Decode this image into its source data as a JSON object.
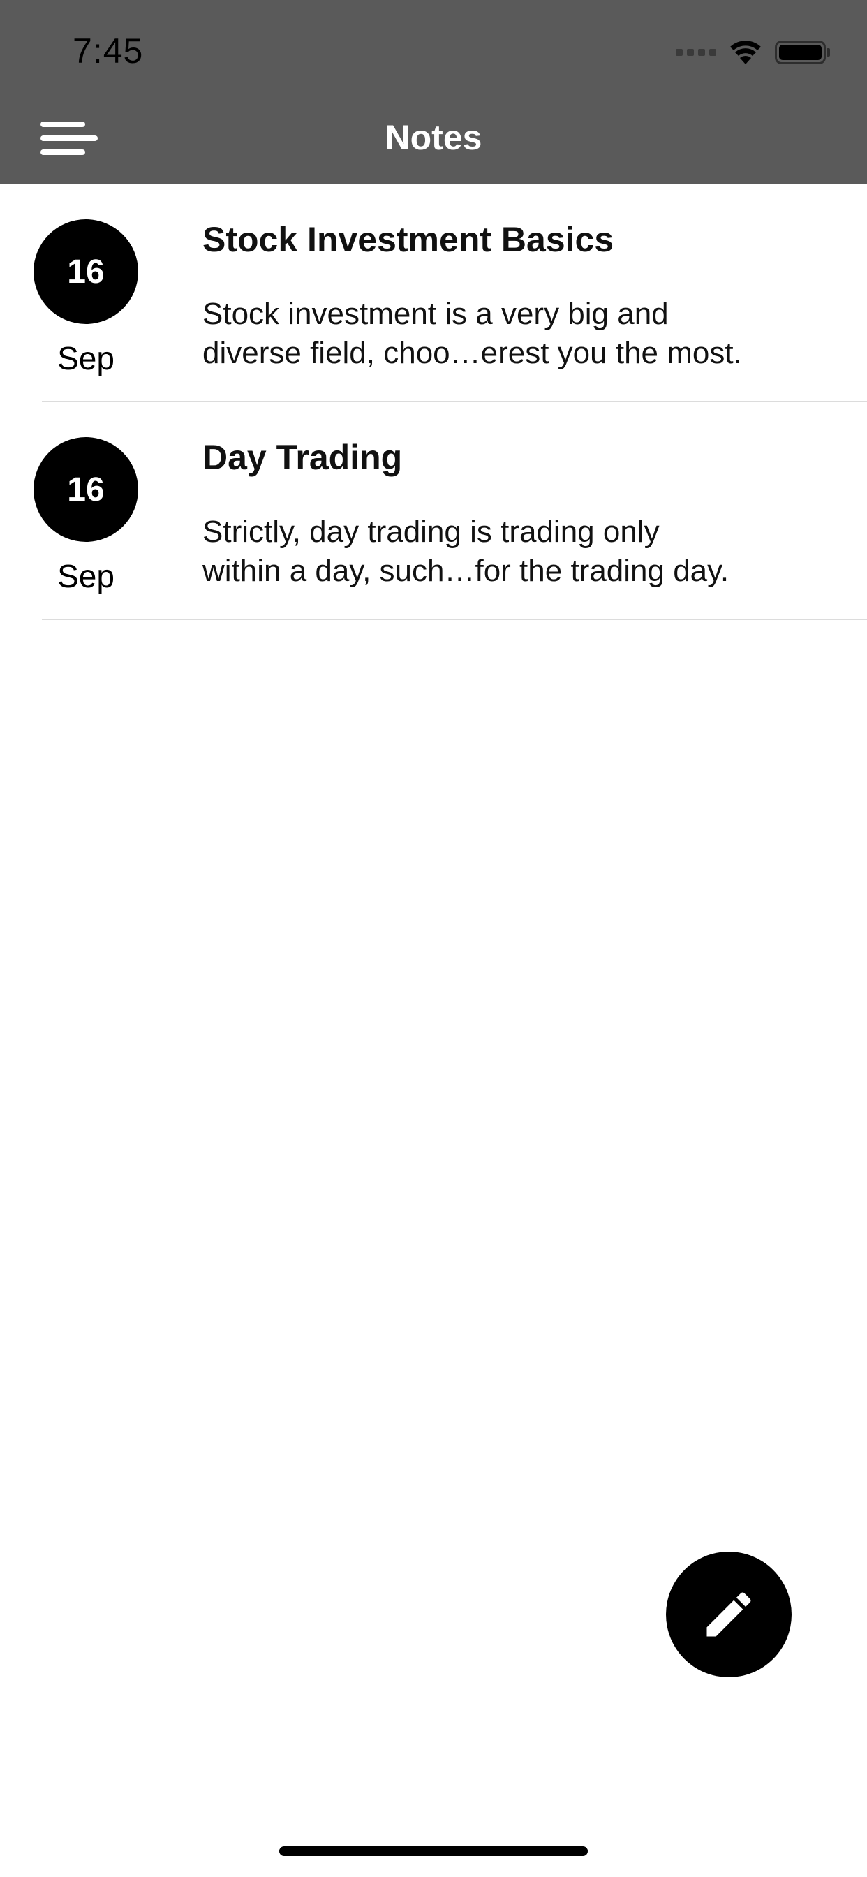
{
  "status_bar": {
    "time": "7:45",
    "icons": [
      "cellular-signal-icon",
      "wifi-icon",
      "battery-icon"
    ]
  },
  "nav_bar": {
    "title": "Notes",
    "menu_icon": "hamburger-menu-icon"
  },
  "notes": [
    {
      "day": "16",
      "month": "Sep",
      "title": "Stock Investment Basics",
      "preview_line1": "Stock investment is a very big and",
      "preview_line2": "diverse field, choo…erest you the most."
    },
    {
      "day": "16",
      "month": "Sep",
      "title": "Day Trading",
      "preview_line1": "Strictly, day trading is trading only",
      "preview_line2": "within a day, such…for the trading day."
    }
  ],
  "fab": {
    "icon": "pencil-icon"
  },
  "colors": {
    "header_background": "#5a5a5a",
    "header_text": "#ffffff",
    "accent": "#000000",
    "background": "#ffffff",
    "divider": "#dcdcdc"
  }
}
